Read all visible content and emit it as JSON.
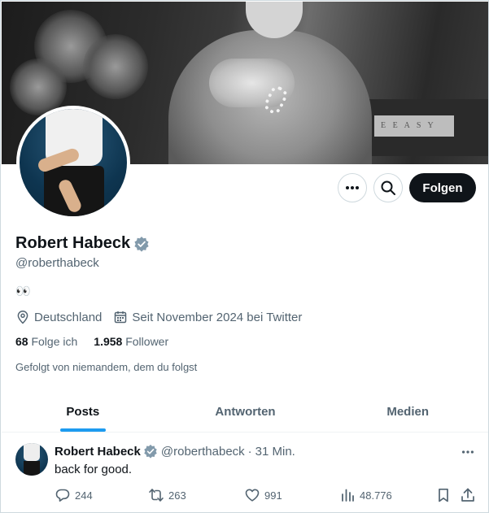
{
  "profile": {
    "name": "Robert Habeck",
    "handle": "@roberthabeck",
    "bio": "👀",
    "location": "Deutschland",
    "joined": "Seit November 2024 bei Twitter",
    "following_count": "68",
    "following_label": "Folge ich",
    "followers_count": "1.958",
    "followers_label": "Follower",
    "followed_by": "Gefolgt von niemandem, dem du folgst"
  },
  "actions": {
    "follow_label": "Folgen",
    "more_icon": "more-icon",
    "search_icon": "search-icon"
  },
  "banner": {
    "sign_text": "E E A S Y"
  },
  "tabs": [
    {
      "label": "Posts",
      "active": true
    },
    {
      "label": "Antworten",
      "active": false
    },
    {
      "label": "Medien",
      "active": false
    }
  ],
  "tweet": {
    "author": "Robert Habeck",
    "handle": "@roberthabeck",
    "separator": "·",
    "time": "31 Min.",
    "text": "back for good.",
    "replies": "244",
    "reposts": "263",
    "likes": "991",
    "views": "48.776"
  },
  "colors": {
    "accent": "#1d9bf0",
    "text_primary": "#0f1419",
    "text_secondary": "#536471",
    "verified_badge": "#829aab",
    "follow_button": "#0f1419"
  }
}
